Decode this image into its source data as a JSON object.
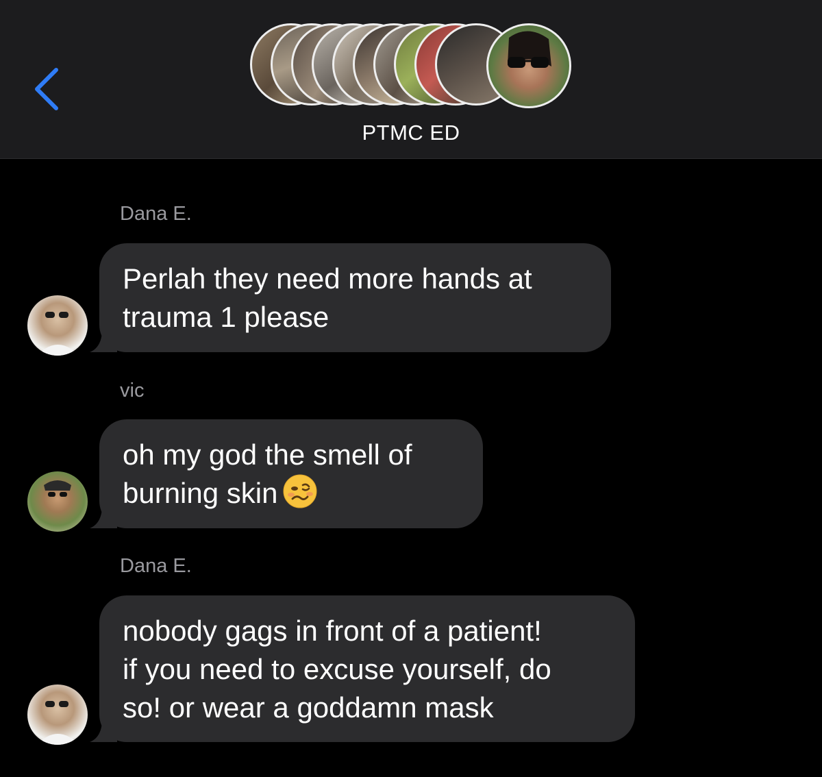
{
  "header": {
    "group_name": "PTMC ED",
    "member_avatar_count": 11
  },
  "messages": [
    {
      "sender": "Dana E.",
      "text": "Perlah they need more hands at\ntrauma 1 please",
      "emoji": null
    },
    {
      "sender": "vic",
      "text": "oh my god the smell of\nburning skin",
      "emoji": "woozy-face"
    },
    {
      "sender": "Dana E.",
      "text": "nobody gags in front of a patient!\nif you need to excuse yourself, do\nso! or wear a goddamn mask",
      "emoji": null
    }
  ],
  "colors": {
    "background": "#000000",
    "header_background": "#1c1c1e",
    "bubble_background": "#2c2c2e",
    "accent_back": "#2f7cf6",
    "sender_label": "#9a9a9f"
  }
}
